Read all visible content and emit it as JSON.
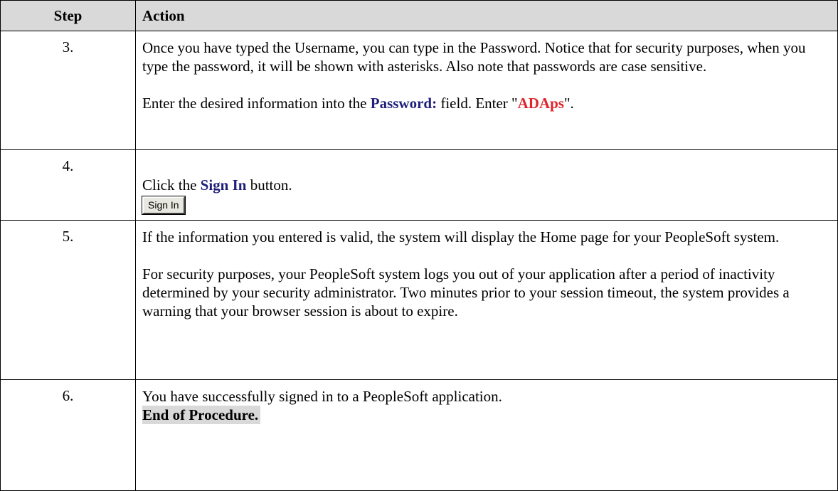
{
  "header": {
    "step": "Step",
    "action": "Action"
  },
  "rows": [
    {
      "step": "3.",
      "text1": "Once you have typed the Username, you can type in the Password.  Notice that for security purposes, when you type the password, it will be shown with asterisks.  Also note that passwords are case sensitive.",
      "line_pre": "Enter the desired information into the ",
      "field": "Password:",
      "line_mid": " field. Enter \"",
      "value": "ADAps",
      "line_post": "\"."
    },
    {
      "step": "4.",
      "pre": "Click the ",
      "field": "Sign In",
      "post": " button.",
      "button_label": "Sign In"
    },
    {
      "step": "5.",
      "text1": "If the information you entered is valid, the system will display the Home page for your PeopleSoft system.",
      "text2": "For security purposes, your PeopleSoft system logs you out of your application after a period of inactivity determined by your security administrator.  Two minutes prior to your session timeout, the system provides a warning that your browser session is about to expire."
    },
    {
      "step": "6.",
      "text1": "You have successfully signed in to a PeopleSoft application.",
      "end": "End of Procedure."
    }
  ],
  "colors": {
    "field": "#1f1f7a",
    "value": "#e0242a",
    "header_bg": "#d9d9d9"
  }
}
